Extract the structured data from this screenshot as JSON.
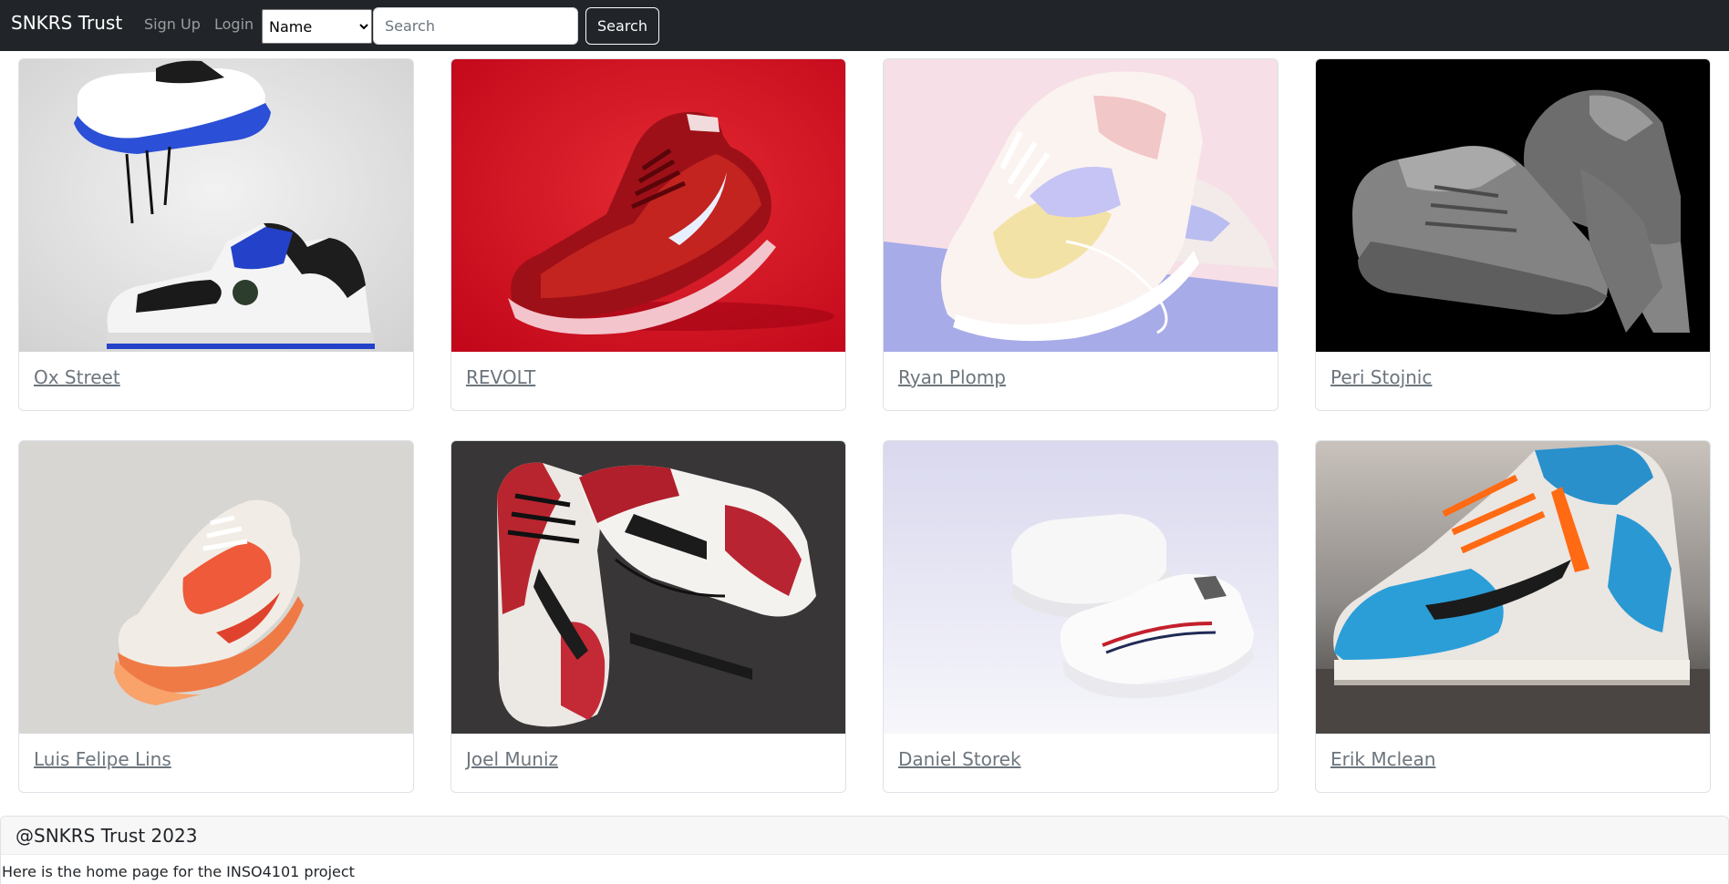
{
  "navbar": {
    "brand": "SNKRS Trust",
    "links": [
      {
        "label": "Sign Up"
      },
      {
        "label": "Login"
      }
    ],
    "filter_select": {
      "selected": "Name",
      "options": [
        "Name"
      ]
    },
    "search": {
      "placeholder": "Search",
      "value": ""
    },
    "search_button": "Search"
  },
  "cards": [
    {
      "title": "Ox Street"
    },
    {
      "title": "REVOLT"
    },
    {
      "title": "Ryan Plomp"
    },
    {
      "title": "Peri Stojnic"
    },
    {
      "title": "Luis Felipe Lins"
    },
    {
      "title": "Joel Muniz"
    },
    {
      "title": "Daniel Storek"
    },
    {
      "title": "Erik Mclean"
    }
  ],
  "footer": {
    "header": "@SNKRS Trust 2023",
    "text": "Here is the home page for the INSO4101 project"
  },
  "colors": {
    "navbar_bg": "#212529",
    "link_muted": "#6c757d",
    "footer_header_bg": "#f7f7f7"
  }
}
